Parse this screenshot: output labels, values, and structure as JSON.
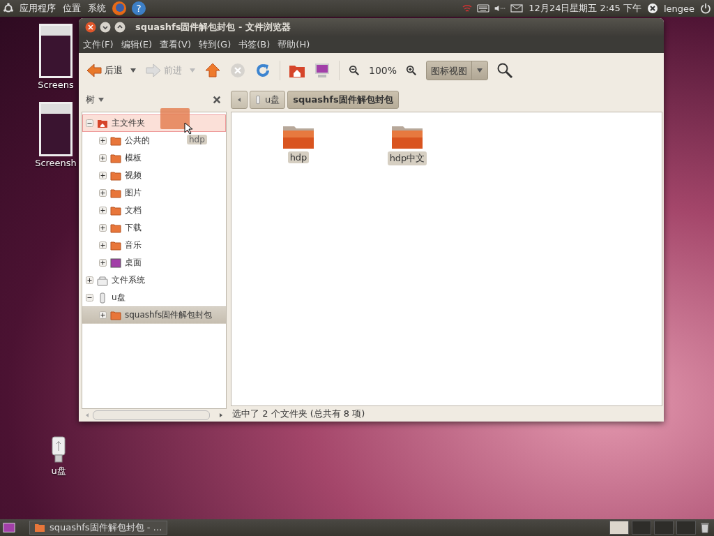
{
  "top_panel": {
    "menus": [
      "应用程序",
      "位置",
      "系统"
    ],
    "clock": "12月24日星期五 2:45 下午",
    "user": "lengee",
    "help_glyph": "?"
  },
  "desktop_icons": [
    {
      "label": "Screens",
      "kind": "screenshot"
    },
    {
      "label": "Screensh",
      "kind": "screenshot"
    },
    {
      "label": "u盘",
      "kind": "drive"
    }
  ],
  "window": {
    "title": "squashfs固件解包封包 - 文件浏览器",
    "menu": [
      "文件(F)",
      "编辑(E)",
      "查看(V)",
      "转到(G)",
      "书签(B)",
      "帮助(H)"
    ],
    "toolbar": {
      "back": "后退",
      "forward": "前进",
      "forward_disabled": true,
      "zoom": "100%",
      "view": "图标视图"
    },
    "sidebar": {
      "header": "树",
      "tree": [
        {
          "label": "主文件夹",
          "kind": "home",
          "expanded": true,
          "selected": false,
          "drop_target": true,
          "children": [
            {
              "label": "公共的",
              "kind": "folder",
              "expanded": false,
              "selected": false,
              "drop_target": false
            },
            {
              "label": "模板",
              "kind": "folder",
              "expanded": false,
              "selected": false,
              "drop_target": false
            },
            {
              "label": "视频",
              "kind": "folder",
              "expanded": false,
              "selected": false,
              "drop_target": false
            },
            {
              "label": "图片",
              "kind": "folder",
              "expanded": false,
              "selected": false,
              "drop_target": false
            },
            {
              "label": "文档",
              "kind": "folder",
              "expanded": false,
              "selected": false,
              "drop_target": false
            },
            {
              "label": "下载",
              "kind": "folder",
              "expanded": false,
              "selected": false,
              "drop_target": false
            },
            {
              "label": "音乐",
              "kind": "folder",
              "expanded": false,
              "selected": false,
              "drop_target": false
            },
            {
              "label": "桌面",
              "kind": "desktop",
              "expanded": false,
              "selected": false,
              "drop_target": false
            }
          ]
        },
        {
          "label": "文件系统",
          "kind": "filesystem",
          "expanded": false,
          "selected": false,
          "drop_target": false
        },
        {
          "label": "u盘",
          "kind": "drive",
          "expanded": true,
          "selected": false,
          "drop_target": false,
          "children": [
            {
              "label": "squashfs固件解包封包",
              "kind": "folder",
              "expanded": false,
              "selected": true,
              "drop_target": false
            }
          ]
        }
      ]
    },
    "drag_item": "hdp",
    "breadcrumbs": [
      {
        "label": "u盘",
        "kind": "drive",
        "selected": false
      },
      {
        "label": "squashfs固件解包封包",
        "kind": "folder",
        "selected": true
      }
    ],
    "files": [
      {
        "name": "hdp",
        "selected": true
      },
      {
        "name": "hdp中文",
        "selected": true
      }
    ],
    "status": "选中了 2 个文件夹 (总共有 8 项)"
  },
  "taskbar": {
    "window_button": "squashfs固件解包封包 - …"
  }
}
